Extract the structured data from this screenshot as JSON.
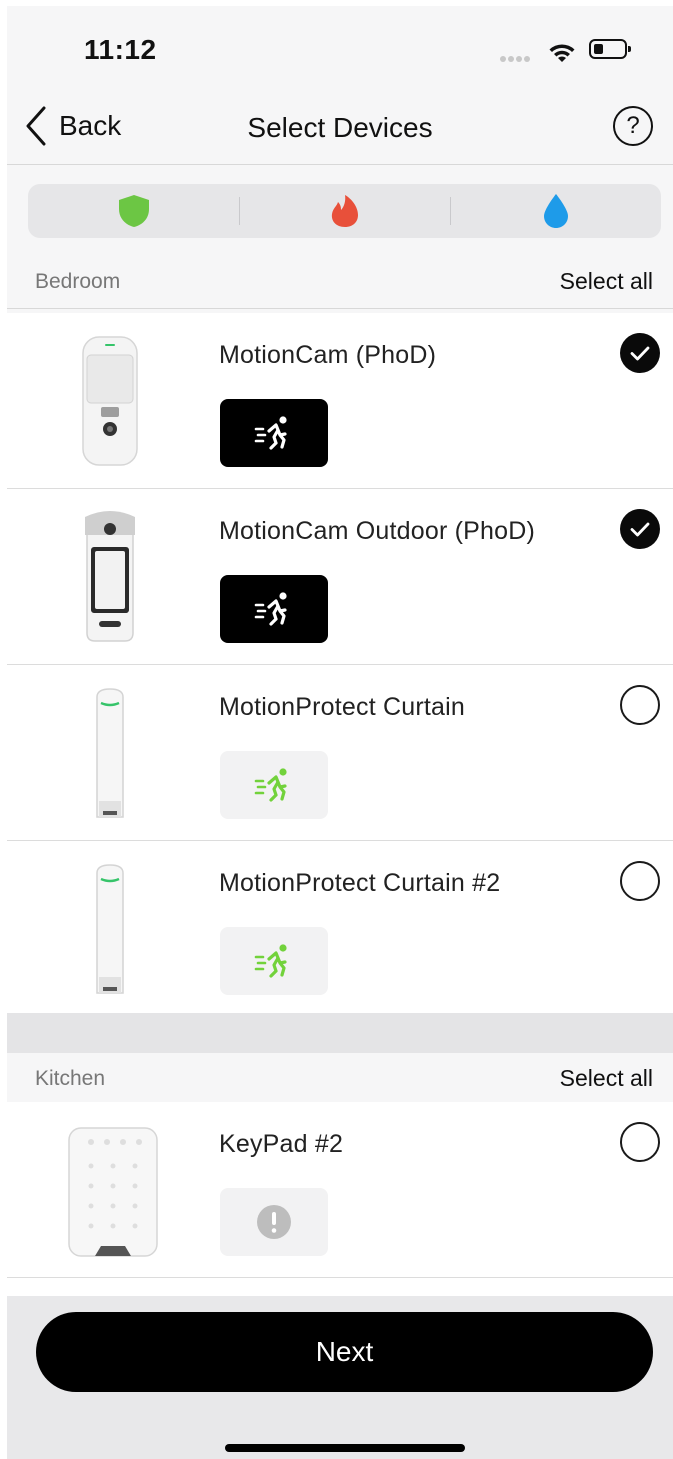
{
  "status_bar": {
    "time": "11:12"
  },
  "nav": {
    "back_label": "Back",
    "title": "Select Devices",
    "help_label": "?"
  },
  "filter_tabs": [
    {
      "icon": "shield-icon",
      "color": "#6cc644"
    },
    {
      "icon": "flame-icon",
      "color": "#e8503a"
    },
    {
      "icon": "water-drop-icon",
      "color": "#1e9be9"
    }
  ],
  "rooms": [
    {
      "name": "Bedroom",
      "select_all_label": "Select all",
      "devices": [
        {
          "name": "MotionCam (PhoD)",
          "checked": true,
          "badge": "running-person-icon",
          "badge_style": "dark"
        },
        {
          "name": "MotionCam Outdoor (PhoD)",
          "checked": true,
          "badge": "running-person-icon",
          "badge_style": "dark"
        },
        {
          "name": "MotionProtect Curtain",
          "checked": false,
          "badge": "running-person-icon",
          "badge_style": "light"
        },
        {
          "name": "MotionProtect Curtain #2",
          "checked": false,
          "badge": "running-person-icon",
          "badge_style": "light"
        }
      ]
    },
    {
      "name": "Kitchen",
      "select_all_label": "Select all",
      "devices": [
        {
          "name": "KeyPad #2",
          "checked": false,
          "badge": "warning-icon",
          "badge_style": "light"
        }
      ]
    }
  ],
  "footer": {
    "next_label": "Next"
  }
}
